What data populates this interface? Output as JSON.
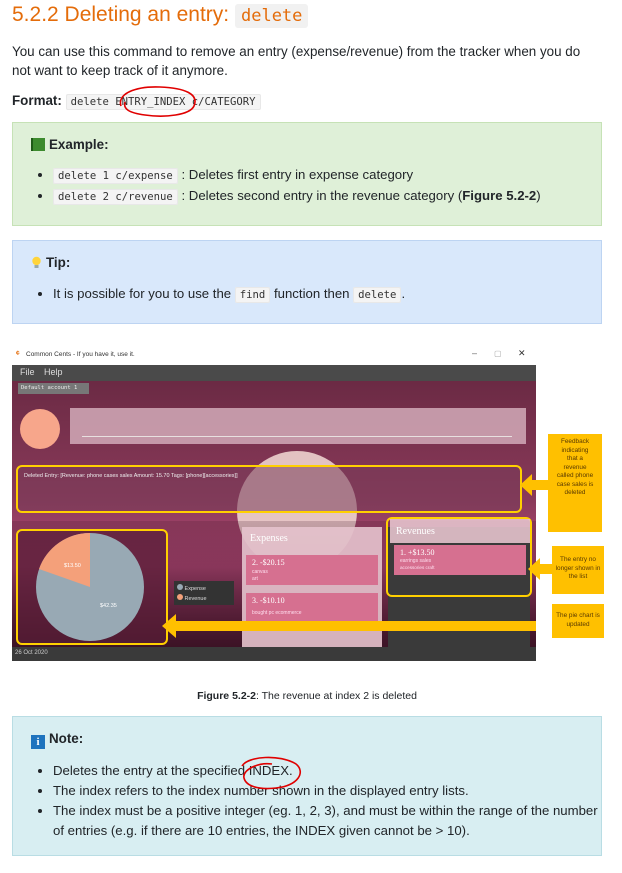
{
  "heading": {
    "text": "5.2.2 Deleting an entry:",
    "code": "delete"
  },
  "intro": "You can use this command to remove an entry (expense/revenue) from the tracker when you do not want to keep track of it anymore.",
  "format": {
    "label": "Format:",
    "code": "delete ENTRY_INDEX c/CATEGORY"
  },
  "example": {
    "title": "Example:",
    "items": [
      {
        "code": "delete 1 c/expense",
        "text": ": Deletes first entry in expense category"
      },
      {
        "code": "delete 2 c/revenue",
        "text": ": Deletes second entry in the revenue category (",
        "bold": "Figure 5.2-2",
        "after": ")"
      }
    ]
  },
  "tip": {
    "title": "Tip:",
    "pre": "It is possible for you to use the ",
    "code1": "find",
    "mid": " function then ",
    "code2": "delete",
    "post": "."
  },
  "screenshot": {
    "window_title": "Common Cents - If you have it, use it.",
    "menu": [
      "File",
      "Help"
    ],
    "account_tab": "Default account 1",
    "feedback": "Deleted Entry: [Revenue: phone cases sales Amount: 15.70 Tags: [phone][accessories]]",
    "expenses_title": "Expenses",
    "revenues_title": "Revenues",
    "expense_items": [
      {
        "label": "2.  -$20.15",
        "desc": "canvas",
        "tag": "art"
      },
      {
        "label": "3.  -$10.10",
        "desc": "bought pc",
        "tag": "ecommerce"
      }
    ],
    "revenue_items": [
      {
        "label": "1.  +$13.50",
        "desc": "earrings sales",
        "tag": "accessories   craft"
      }
    ],
    "pie": {
      "expense_label": "$13.50",
      "revenue_label": "$42.35"
    },
    "legend": [
      "Expense",
      "Revenue"
    ],
    "date": "26 Oct 2020",
    "callouts": {
      "feedback": "Feedback indicating that a revenue called phone case sales is deleted",
      "entry": "The entry no longer shown in the list",
      "pie": "The pie chart is updated"
    },
    "colors": {
      "expense": "#f4a07a",
      "revenue": "#98a9b4",
      "accent": "#ffc000"
    }
  },
  "caption": {
    "bold": "Figure 5.2-2",
    "text": ": The revenue at index 2 is deleted"
  },
  "note": {
    "title": "Note:",
    "items": [
      "Deletes the entry at the specified INDEX.",
      "The index refers to the index number shown in the displayed entry lists.",
      "The index must be a positive integer (eg. 1, 2, 3), and must be within the range of the number of entries (e.g. if there are 10 entries, the INDEX given cannot be > 10)."
    ]
  }
}
